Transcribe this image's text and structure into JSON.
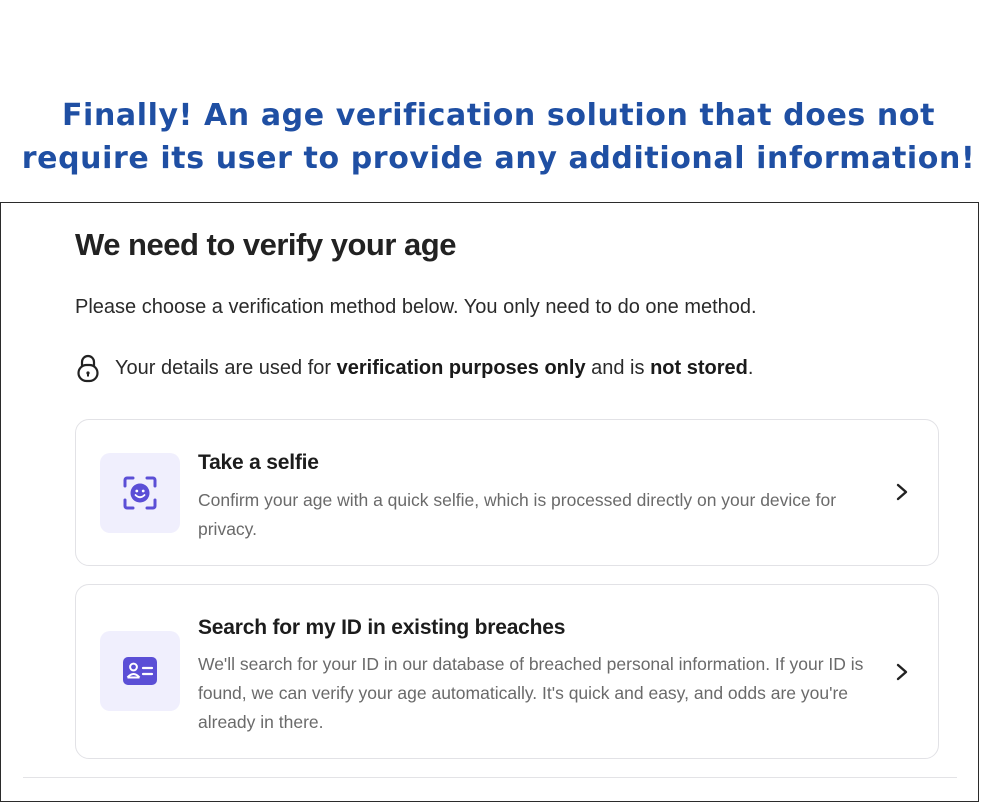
{
  "caption": {
    "line1": "Finally!  An age verification solution that does not",
    "line2": "require its user to provide any additional information!"
  },
  "dialog": {
    "title": "We need to verify your age",
    "instructions": "Please choose a verification method below. You only need to do one method.",
    "privacy": {
      "prefix": "Your details are used for ",
      "bold1": "verification purposes only",
      "middle": " and is ",
      "bold2": "not stored",
      "suffix": "."
    },
    "options": [
      {
        "title": "Take a selfie",
        "description": "Confirm your age with a quick selfie, which is processed directly on your device for privacy.",
        "icon": "face-scan-icon"
      },
      {
        "title": "Search for my ID in existing breaches",
        "description": "We'll search for your ID in our database of breached personal information. If your ID is found, we can verify your age automatically. It's quick and easy, and odds are you're already in there.",
        "icon": "id-card-icon"
      }
    ]
  },
  "colors": {
    "caption": "#1f4fa3",
    "accent": "#5b4fd6",
    "icon_tile_bg": "#f0effd"
  }
}
